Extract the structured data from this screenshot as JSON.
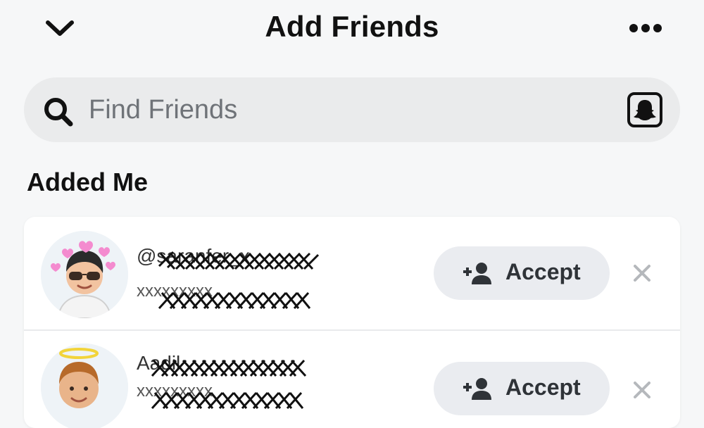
{
  "header": {
    "title": "Add Friends",
    "back_icon": "chevron-down-icon",
    "more_icon": "more-horizontal-icon"
  },
  "search": {
    "placeholder": "Find Friends",
    "value": "",
    "icon": "search-icon",
    "snapcode_icon": "snapcode-ghost-icon"
  },
  "section": {
    "title": "Added Me"
  },
  "requests": [
    {
      "name": "@saranfer_x",
      "username": "xxxxxxxxx",
      "action_label": "Accept",
      "action_icon": "add-friend-icon",
      "dismiss_icon": "close-icon"
    },
    {
      "name": "Aadil",
      "username": "xxxxxxxxx",
      "action_label": "Accept",
      "action_icon": "add-friend-icon",
      "dismiss_icon": "close-icon"
    }
  ],
  "colors": {
    "background": "#f6f7f8",
    "search_bg": "#eaebec",
    "card_bg": "#ffffff",
    "button_bg": "#eaecf0",
    "text_primary": "#111111",
    "placeholder": "#6f7378"
  }
}
